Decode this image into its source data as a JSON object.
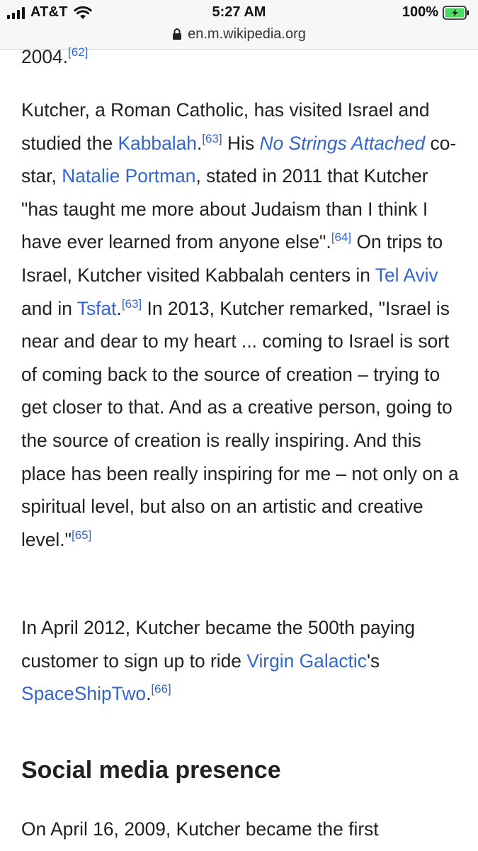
{
  "status_bar": {
    "carrier": "AT&T",
    "time": "5:27 AM",
    "battery_percent": "100%",
    "url": "en.m.wikipedia.org"
  },
  "article": {
    "top_fragment": {
      "text": "2004.",
      "ref": "[62]"
    },
    "p1": {
      "t1": "Kutcher, a Roman Catholic, has visited Israel and studied the ",
      "link_kabbalah": "Kabbalah",
      "t2": ".",
      "ref63a": "[63]",
      "t3": " His ",
      "link_nsa": "No Strings Attached",
      "t4": " co-star, ",
      "link_portman": "Natalie Portman",
      "t5": ", stated in 2011 that Kutcher \"has taught me more about Judaism than I think I have ever learned from anyone else\".",
      "ref64": "[64]",
      "t6": " On trips to Israel, Kutcher visited Kabbalah centers in ",
      "link_telaviv": "Tel Aviv",
      "t7": " and in ",
      "link_tsfat": "Tsfat",
      "t8": ".",
      "ref63b": "[63]",
      "t9": " In 2013, Kutcher remarked, \"Israel is near and dear to my heart ... coming to Israel is sort of coming back to the source of creation – trying to get closer to that. And as a creative person, going to the source of creation is really inspiring. And this place has been really inspiring for me – not only on a spiritual level, but also on an artistic and creative level.\"",
      "ref65": "[65]"
    },
    "p2": {
      "t1": "In April 2012, Kutcher became the 500th paying customer to sign up to ride ",
      "link_virgin": "Virgin Galactic",
      "t2": "'s ",
      "link_spaceship": "SpaceShipTwo",
      "t3": ".",
      "ref66": "[66]"
    },
    "section_heading": "Social media presence",
    "p3": {
      "t1": "On April 16, 2009, Kutcher became the first"
    }
  },
  "colors": {
    "link": "#3366cc",
    "text": "#202122",
    "battery_fill": "#4cd964",
    "status_bar_bg": "#f7f7f7"
  },
  "icons": [
    "signal-icon",
    "wifi-icon",
    "lock-icon",
    "battery-icon"
  ]
}
